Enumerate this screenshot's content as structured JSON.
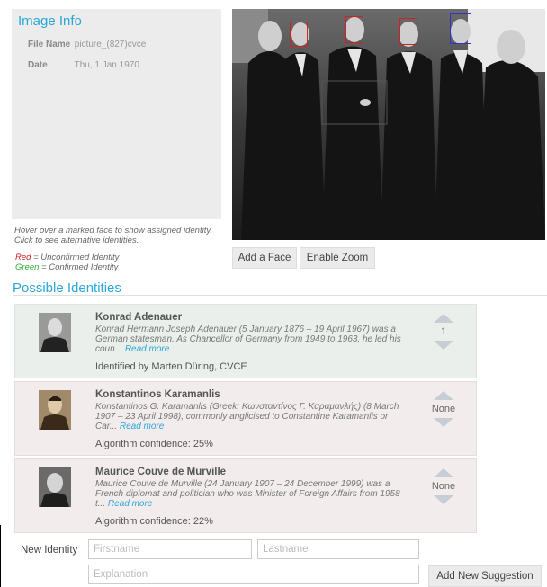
{
  "image_info": {
    "title": "Image Info",
    "file_name_label": "File Name",
    "file_name": "picture_(827)cvce",
    "date_label": "Date",
    "date": "Thu, 1 Jan 1970"
  },
  "hint": "Hover over a marked face to show assigned identity. Click to see alternative identities.",
  "legend": {
    "red_word": "Red",
    "red_text": " = Unconfirmed Identity",
    "green_word": "Green",
    "green_text": " = Confirmed Identity",
    "red_color": "#cc2222",
    "green_color": "#33aa33",
    "selected_color": "#3333cc"
  },
  "photo_buttons": {
    "add_face": "Add a Face",
    "enable_zoom": "Enable Zoom"
  },
  "possible_identities_title": "Possible Identities",
  "identities": [
    {
      "name": "Konrad Adenauer",
      "description": "Konrad Hermann Joseph Adenauer (5 January 1876 – 19 April 1967) was a German statesman. As Chancellor of Germany from 1949 to 1963, he led his coun...",
      "read_more": "Read more",
      "meta": "Identified by Marten Düring, CVCE",
      "votes": "1"
    },
    {
      "name": "Konstantinos Karamanlis",
      "description": "Konstantinos G. Karamanlis (Greek: Κωνσταντίνος Γ. Καραμανλής) (8 March 1907 – 23 April 1998), commonly anglicised to Constantine Karamanlis or Car...",
      "read_more": "Read more",
      "meta": "Algorithm confidence: 25%",
      "votes": "None"
    },
    {
      "name": "Maurice Couve de Murville",
      "description": "Maurice Couve de Murville (24 January 1907 – 24 December 1999) was a French diplomat and politician who was Minister of Foreign Affairs from 1958 t...",
      "read_more": "Read more",
      "meta": "Algorithm confidence: 22%",
      "votes": "None"
    }
  ],
  "new_identity": {
    "label": "New Identity",
    "firstname_placeholder": "Firstname",
    "lastname_placeholder": "Lastname",
    "explanation_placeholder": "Explanation",
    "submit": "Add New Suggestion"
  }
}
